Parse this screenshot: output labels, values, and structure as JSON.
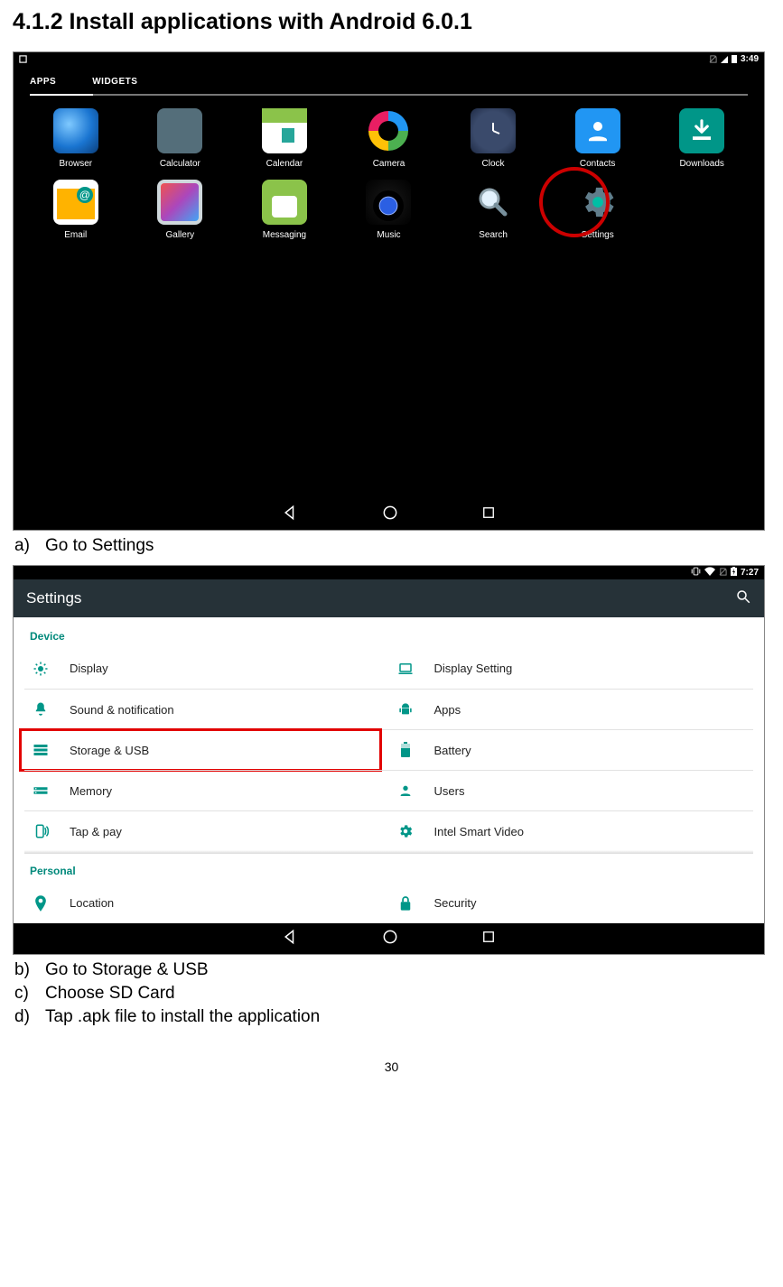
{
  "heading": "4.1.2 Install applications with Android 6.0.1",
  "shot1": {
    "time": "3:49",
    "tabs": {
      "apps": "APPS",
      "widgets": "WIDGETS"
    },
    "apps": [
      {
        "id": "browser",
        "label": "Browser"
      },
      {
        "id": "calculator",
        "label": "Calculator"
      },
      {
        "id": "calendar",
        "label": "Calendar"
      },
      {
        "id": "camera",
        "label": "Camera"
      },
      {
        "id": "clock",
        "label": "Clock"
      },
      {
        "id": "contacts",
        "label": "Contacts"
      },
      {
        "id": "downloads",
        "label": "Downloads"
      },
      {
        "id": "email",
        "label": "Email"
      },
      {
        "id": "gallery",
        "label": "Gallery"
      },
      {
        "id": "messaging",
        "label": "Messaging"
      },
      {
        "id": "music",
        "label": "Music"
      },
      {
        "id": "search",
        "label": "Search"
      },
      {
        "id": "settings",
        "label": "Settings"
      }
    ]
  },
  "steps": {
    "a": {
      "bullet": "a)",
      "text": "Go to Settings"
    },
    "b": {
      "bullet": "b)",
      "text": "Go to Storage & USB"
    },
    "c": {
      "bullet": "c)",
      "text": "Choose SD Card"
    },
    "d": {
      "bullet": "d)",
      "text": "Tap .apk file to install the application"
    }
  },
  "shot2": {
    "time": "7:27",
    "appbar_title": "Settings",
    "category_device": "Device",
    "category_personal": "Personal",
    "rows": {
      "display": "Display",
      "display_setting": "Display Setting",
      "sound": "Sound & notification",
      "apps": "Apps",
      "storage": "Storage & USB",
      "battery": "Battery",
      "memory": "Memory",
      "users": "Users",
      "tap_pay": "Tap & pay",
      "smart_video": "Intel Smart Video",
      "location": "Location",
      "security": "Security"
    }
  },
  "page_number": "30"
}
